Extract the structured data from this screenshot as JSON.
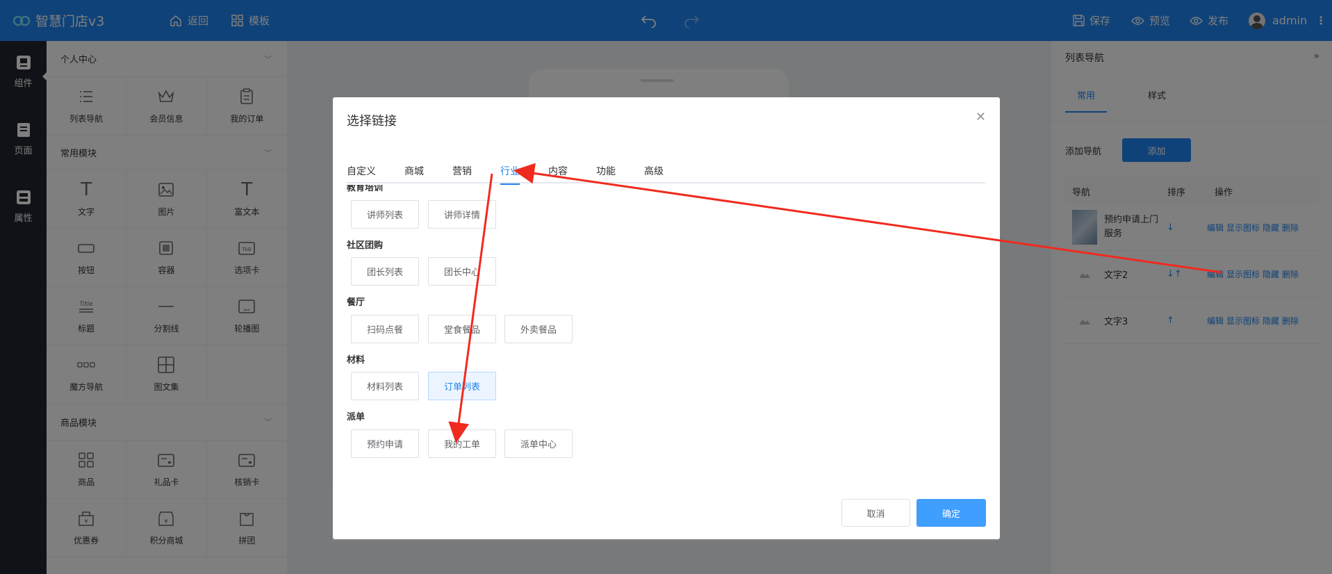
{
  "app": {
    "title": "智慧门店v3",
    "back": "返回",
    "template": "模板",
    "save": "保存",
    "preview": "预览",
    "publish": "发布",
    "user": "admin"
  },
  "rail": [
    {
      "label": "组件",
      "active": true
    },
    {
      "label": "页面",
      "active": false
    },
    {
      "label": "属性",
      "active": false
    }
  ],
  "panel": {
    "groups": [
      {
        "title": "个人中心",
        "items": [
          {
            "label": "列表导航",
            "icon": "list-icon"
          },
          {
            "label": "会员信息",
            "icon": "crown-icon"
          },
          {
            "label": "我的订单",
            "icon": "clipboard-icon"
          }
        ]
      },
      {
        "title": "常用模块",
        "items": [
          {
            "label": "文字",
            "icon": "text-icon"
          },
          {
            "label": "图片",
            "icon": "image-icon"
          },
          {
            "label": "富文本",
            "icon": "rich-text-icon"
          },
          {
            "label": "按钮",
            "icon": "button-icon"
          },
          {
            "label": "容器",
            "icon": "container-icon"
          },
          {
            "label": "选项卡",
            "icon": "tab-icon"
          },
          {
            "label": "标题",
            "icon": "title-icon"
          },
          {
            "label": "分割线",
            "icon": "divider-icon"
          },
          {
            "label": "轮播图",
            "icon": "carousel-icon"
          },
          {
            "label": "魔方导航",
            "icon": "cube-nav-icon"
          },
          {
            "label": "图文集",
            "icon": "grid-icon"
          }
        ]
      },
      {
        "title": "商品模块",
        "items": [
          {
            "label": "商品",
            "icon": "goods-icon"
          },
          {
            "label": "礼品卡",
            "icon": "gift-card-icon"
          },
          {
            "label": "核销卡",
            "icon": "verify-card-icon"
          },
          {
            "label": "优惠券",
            "icon": "coupon-icon"
          },
          {
            "label": "积分商城",
            "icon": "points-mall-icon"
          },
          {
            "label": "拼团",
            "icon": "group-buy-icon"
          }
        ]
      }
    ]
  },
  "right": {
    "title": "列表导航",
    "tabs": [
      "常用",
      "样式"
    ],
    "add_label": "添加导航",
    "add_button": "添加",
    "columns": [
      "导航",
      "排序",
      "操作"
    ],
    "rows": [
      {
        "name": "预约申请上门服务",
        "sort": "↓",
        "actions": [
          "编辑",
          "显示图标",
          "隐藏",
          "删除"
        ]
      },
      {
        "name": "文字2",
        "sort": "↓↑",
        "actions": [
          "编辑",
          "显示图标",
          "隐藏",
          "删除"
        ]
      },
      {
        "name": "文字3",
        "sort": "↑",
        "actions": [
          "编辑",
          "显示图标",
          "隐藏",
          "删除"
        ]
      }
    ]
  },
  "background_buttons": {
    "cancel": "取消",
    "ok": "确定"
  },
  "modal": {
    "title": "选择链接",
    "tabs": [
      "自定义",
      "商城",
      "营销",
      "行业",
      "内容",
      "功能",
      "高级"
    ],
    "active_tab": "行业",
    "sections": [
      {
        "title": "教育培训",
        "items": [
          "讲师列表",
          "讲师详情"
        ]
      },
      {
        "title": "社区团购",
        "items": [
          "团长列表",
          "团长中心"
        ]
      },
      {
        "title": "餐厅",
        "items": [
          "扫码点餐",
          "堂食餐品",
          "外卖餐品"
        ]
      },
      {
        "title": "材料",
        "items": [
          "材料列表",
          "订单列表"
        ]
      },
      {
        "title": "派单",
        "items": [
          "预约申请",
          "我的工单",
          "派单中心"
        ]
      }
    ],
    "selected": "订单列表",
    "cancel": "取消",
    "ok": "确定"
  },
  "colors": {
    "primary": "#1e84f0",
    "annotation": "#f02a1e"
  }
}
